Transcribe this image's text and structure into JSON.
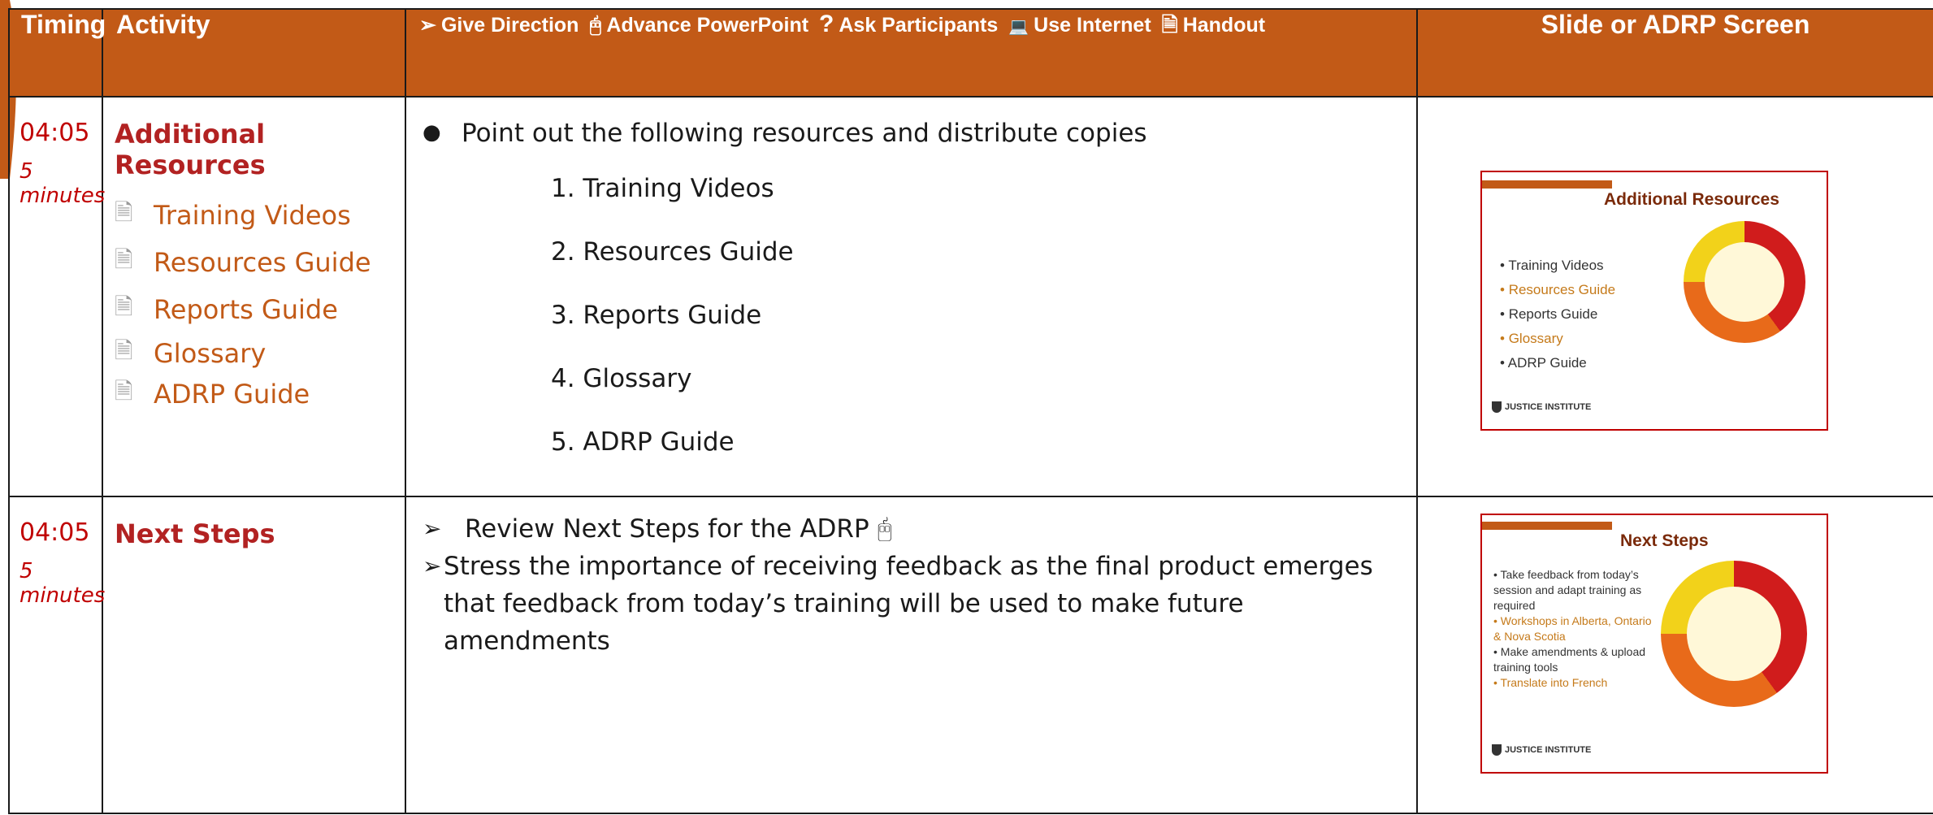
{
  "header": {
    "timing": "Timing",
    "activity": "Activity",
    "legend": [
      {
        "icon": "arrow-icon",
        "glyph": "➢",
        "label": "Give Direction"
      },
      {
        "icon": "mouse-click-icon",
        "glyph": "🖰",
        "label": "Advance PowerPoint"
      },
      {
        "icon": "question-icon",
        "glyph": "?",
        "label": "Ask Participants"
      },
      {
        "icon": "laptop-icon",
        "glyph": "💻",
        "label": "Use Internet"
      },
      {
        "icon": "handout-icon",
        "glyph": "🗎",
        "label": "Handout"
      }
    ],
    "slide": "Slide or ADRP Screen"
  },
  "rows": [
    {
      "time": "04:05",
      "duration": "5 minutes",
      "activity_title": "Additional Resources",
      "resources": [
        "Training Videos",
        "Resources Guide",
        "Reports Guide",
        "Glossary",
        "ADRP Guide"
      ],
      "direction_bullet": "Point out the following resources and distribute copies",
      "numbered": [
        "1.  Training Videos",
        "2.  Resources Guide",
        "3.  Reports Guide",
        "4.  Glossary",
        "5.  ADRP Guide"
      ],
      "slide": {
        "title": "Additional Resources",
        "bullets": [
          "Training Videos",
          "Resources Guide",
          "Reports Guide",
          "Glossary",
          "ADRP Guide"
        ],
        "logo": "JUSTICE INSTITUTE"
      }
    },
    {
      "time": "04:05",
      "duration": "5 minutes",
      "activity_title": "Next Steps",
      "directions": [
        "Review Next Steps for the ADRP 🖰",
        "Stress the importance of receiving feedback as the final product emerges that feedback from today’s training will be used to make future amendments"
      ],
      "slide": {
        "title": "Next Steps",
        "bullets": [
          "Take feedback from today’s session and adapt training as required",
          "Workshops in Alberta, Ontario & Nova Scotia",
          "Make amendments & upload training tools",
          "Translate into French"
        ],
        "logo": "JUSTICE INSTITUTE"
      }
    }
  ],
  "colors": {
    "header_bg": "#c25a17",
    "time_red": "#c00000",
    "resource_orange": "#c25a17",
    "slide_border": "#c00000"
  }
}
